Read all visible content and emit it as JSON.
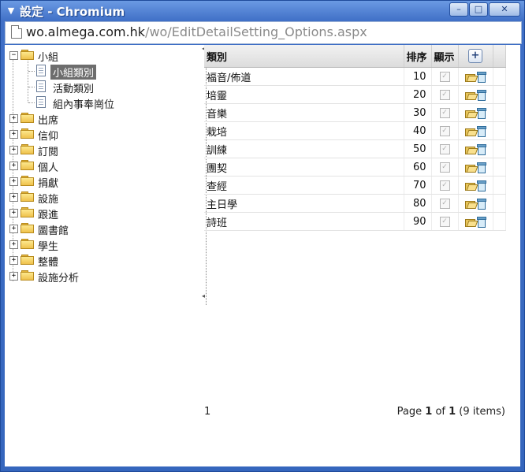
{
  "window": {
    "title": "設定 - Chromium",
    "controls": {
      "minimize": "–",
      "maximize": "□",
      "close": "✕"
    }
  },
  "address": {
    "host": "wo.almega.com.hk",
    "path": "/wo/EditDetailSetting_Options.aspx"
  },
  "tree": {
    "root": {
      "label": "小組",
      "expanded": true,
      "expander": "−",
      "children": [
        {
          "label": "小組類別",
          "selected": true
        },
        {
          "label": "活動類別"
        },
        {
          "label": "組內事奉崗位"
        }
      ]
    },
    "nodes": [
      {
        "label": "出席",
        "expander": "+"
      },
      {
        "label": "信仰",
        "expander": "+"
      },
      {
        "label": "訂閱",
        "expander": "+"
      },
      {
        "label": "個人",
        "expander": "+"
      },
      {
        "label": "捐獻",
        "expander": "+"
      },
      {
        "label": "設施",
        "expander": "+"
      },
      {
        "label": "跟進",
        "expander": "+"
      },
      {
        "label": "圖書館",
        "expander": "+"
      },
      {
        "label": "學生",
        "expander": "+"
      },
      {
        "label": "整體",
        "expander": "+"
      },
      {
        "label": "設施分析",
        "expander": "+"
      }
    ]
  },
  "grid": {
    "headers": {
      "category": "類別",
      "order": "排序",
      "display": "顯示",
      "add": "+"
    },
    "check_mark": "✓",
    "rows": [
      {
        "category": "福音/佈道",
        "order": "10",
        "display": true
      },
      {
        "category": "培靈",
        "order": "20",
        "display": true
      },
      {
        "category": "音樂",
        "order": "30",
        "display": true
      },
      {
        "category": "栽培",
        "order": "40",
        "display": true
      },
      {
        "category": "訓練",
        "order": "50",
        "display": true
      },
      {
        "category": "團契",
        "order": "60",
        "display": true
      },
      {
        "category": "查經",
        "order": "70",
        "display": true
      },
      {
        "category": "主日學",
        "order": "80",
        "display": true
      },
      {
        "category": "詩班",
        "order": "90",
        "display": true
      }
    ]
  },
  "pager": {
    "current_page_link": "1",
    "summary_prefix": "Page ",
    "page": "1",
    "of": " of ",
    "total_pages": "1",
    "items_text": " (9 items)"
  },
  "icons": {
    "title_icon": "chromium-icon",
    "page_icon": "page-icon",
    "edit_icon": "open-folder-icon",
    "delete_icon": "recycle-bin-icon"
  }
}
